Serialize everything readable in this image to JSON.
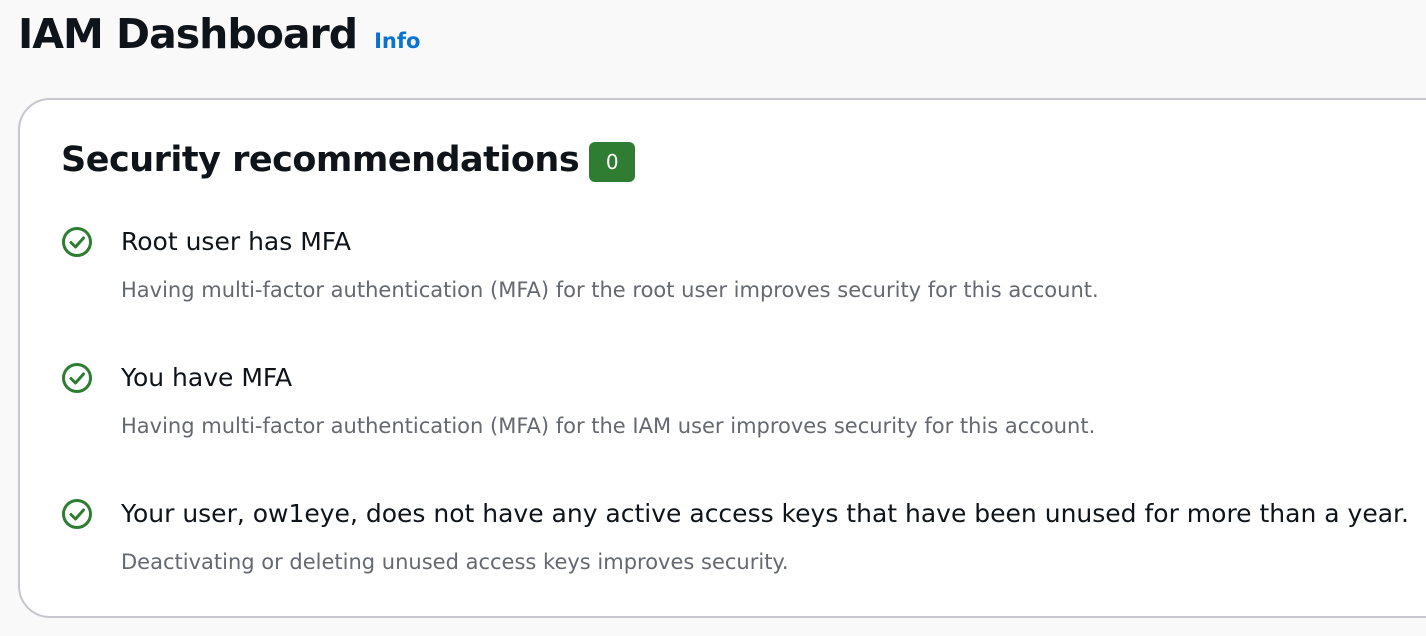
{
  "header": {
    "title": "IAM Dashboard",
    "info_link": "Info"
  },
  "security": {
    "title": "Security recommendations",
    "count": "0",
    "items": [
      {
        "icon": "check-circle-icon",
        "title": "Root user has MFA",
        "description": "Having multi-factor authentication (MFA) for the root user improves security for this account."
      },
      {
        "icon": "check-circle-icon",
        "title": "You have MFA",
        "description": "Having multi-factor authentication (MFA) for the IAM user improves security for this account."
      },
      {
        "icon": "check-circle-icon",
        "title": "Your user, ow1eye, does not have any active access keys that have been unused for more than a year.",
        "description": "Deactivating or deleting unused access keys improves security."
      }
    ]
  },
  "colors": {
    "success": "#2e7d32",
    "link": "#0972d3",
    "secondary_text": "#656871"
  }
}
